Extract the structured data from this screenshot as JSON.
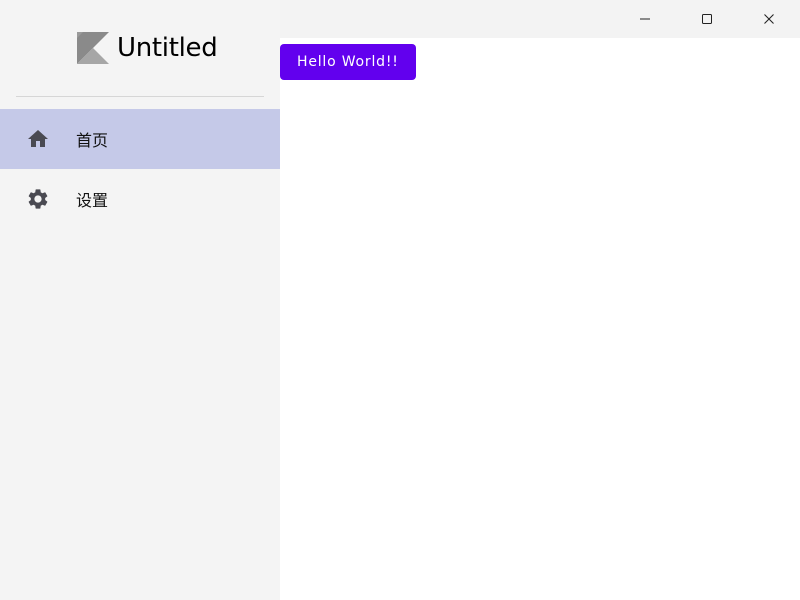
{
  "window": {
    "controls": [
      {
        "name": "minimize",
        "icon": "minimize-icon"
      },
      {
        "name": "maximize",
        "icon": "maximize-icon"
      },
      {
        "name": "close",
        "icon": "close-icon"
      }
    ]
  },
  "sidebar": {
    "app_title": "Untitled",
    "logo_icon": "kotlin-logo-icon",
    "items": [
      {
        "label": "首页",
        "icon": "home-icon",
        "selected": true
      },
      {
        "label": "设置",
        "icon": "gear-icon",
        "selected": false
      }
    ]
  },
  "main": {
    "button_label": "Hello World!!"
  },
  "colors": {
    "sidebar_bg": "#f4f4f4",
    "selected_item_bg": "#c5c9e8",
    "content_bg": "#ffffff",
    "button_bg": "#6200ee",
    "button_text": "#ffffff",
    "icon_color": "#4a4a52",
    "logo_color": "#8a8a8a"
  }
}
